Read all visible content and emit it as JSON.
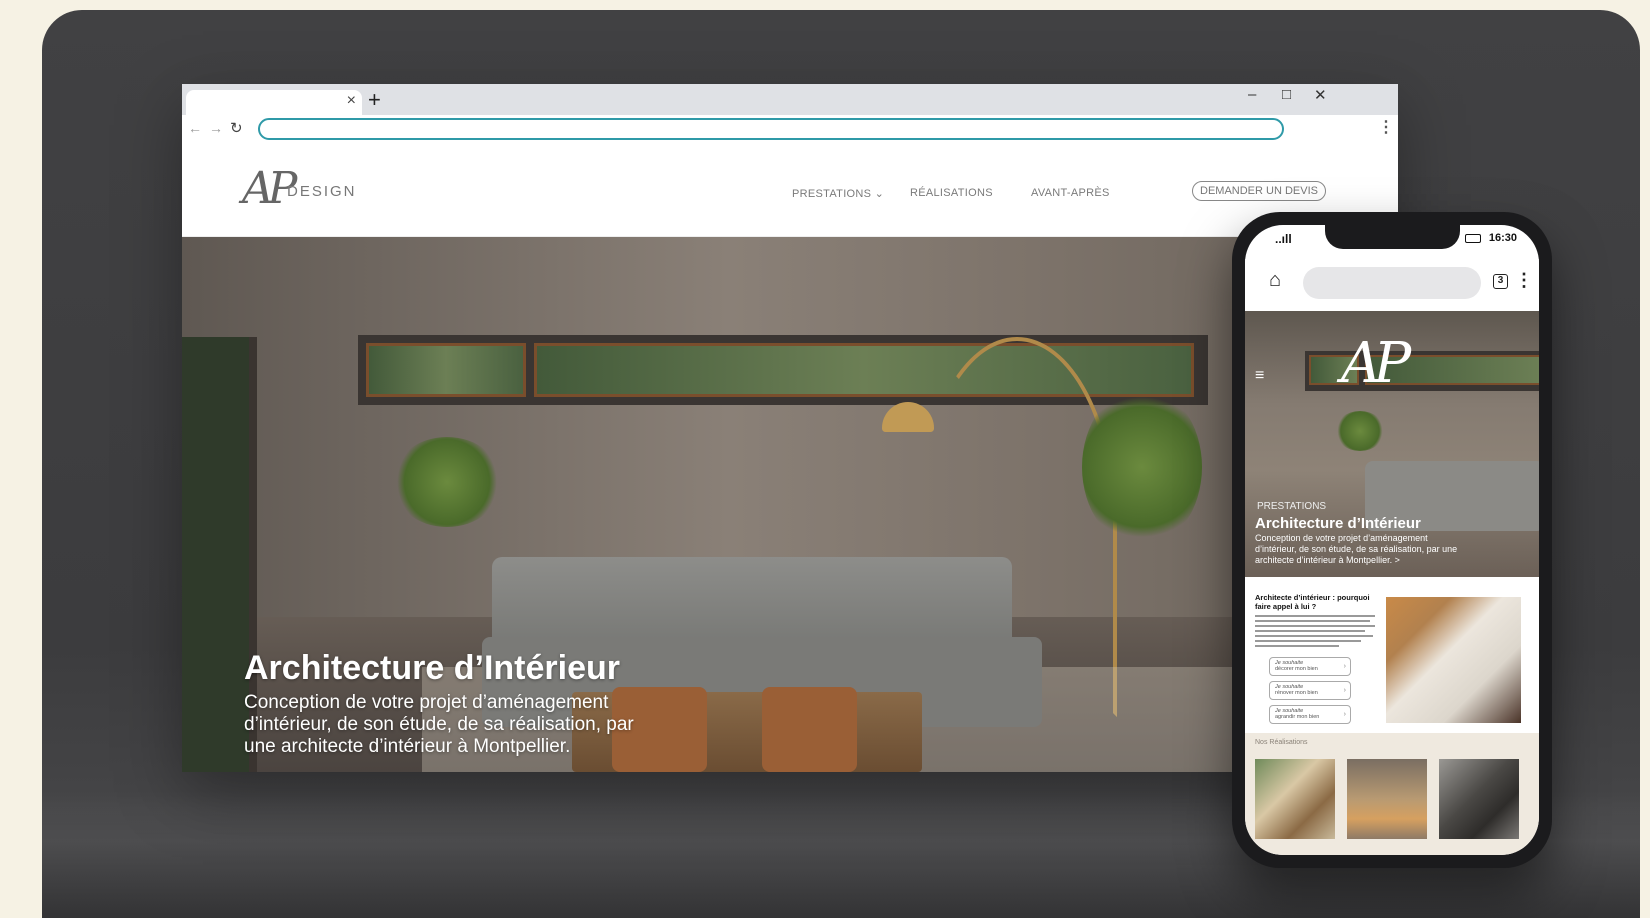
{
  "browser": {
    "tab_close": "×",
    "new_tab": "+",
    "window_controls": {
      "minimize": "–",
      "maximize": "□",
      "close": "✕"
    },
    "nav": {
      "back": "←",
      "forward": "→",
      "reload": "↻"
    },
    "address_bar_value": "",
    "menu": "⋮"
  },
  "site": {
    "logo_mark": "AP",
    "logo_word": "DESIGN",
    "nav": [
      {
        "label": "PRESTATIONS ⌄"
      },
      {
        "label": "RÉALISATIONS"
      },
      {
        "label": "AVANT-APRÈS"
      }
    ],
    "cta": "DEMANDER UN DEVIS",
    "hero": {
      "title": "Architecture d’Intérieur",
      "description": "Conception de votre projet d’aménagement d’intérieur, de son étude, de sa réalisation, par une architecte d’intérieur à Montpellier."
    }
  },
  "phone": {
    "status": {
      "time": "16:30",
      "signal": "..ıll"
    },
    "toolbar": {
      "home": "⌂",
      "tab_count": "3",
      "menu": "⋮"
    },
    "hero": {
      "menu_icon": "≡",
      "logo": "AP",
      "eyebrow": "PRESTATIONS",
      "title": "Architecture d’Intérieur",
      "description": "Conception de votre projet d’aménagement d’intérieur, de son étude, de sa réalisation, par une architecte d’intérieur à Montpellier. >"
    },
    "article": {
      "title": "Architecte d’intérieur : pourquoi faire appel à lui ?",
      "buttons": [
        {
          "script": "Je souhaite",
          "label": "décorer mon bien"
        },
        {
          "script": "Je souhaite",
          "label": "rénover mon bien"
        },
        {
          "script": "Je souhaite",
          "label": "agrandir mon bien"
        }
      ]
    },
    "gallery": {
      "label": "Nos Réalisations"
    }
  },
  "colors": {
    "background": "#f6f2e4",
    "stage": "#3f3f41",
    "address_bar_border": "#2f9aa8"
  }
}
